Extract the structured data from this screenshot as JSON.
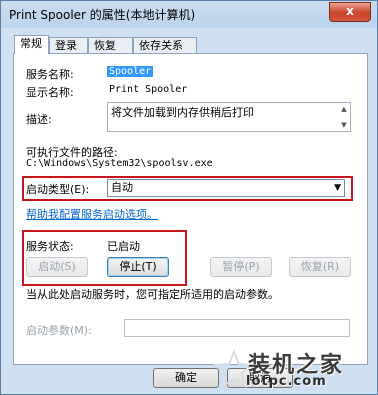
{
  "window": {
    "title": "Print Spooler 的属性(本地计算机)",
    "close_glyph": "x"
  },
  "tabs": [
    {
      "label": "常规",
      "active": true
    },
    {
      "label": "登录",
      "active": false
    },
    {
      "label": "恢复",
      "active": false
    },
    {
      "label": "依存关系",
      "active": false
    }
  ],
  "general": {
    "service_name_label": "服务名称:",
    "service_name_value": "Spooler",
    "display_name_label": "显示名称:",
    "display_name_value": "Print Spooler",
    "description_label": "描述:",
    "description_value": "将文件加载到内存供稍后打印",
    "exec_path_label": "可执行文件的路径:",
    "exec_path_value": "C:\\Windows\\System32\\spoolsv.exe",
    "startup_type_label": "启动类型(E):",
    "startup_type_value": "自动",
    "help_link": "帮助我配置服务启动选项。",
    "service_status_label": "服务状态:",
    "service_status_value": "已启动",
    "buttons": {
      "start": "启动(S)",
      "stop": "停止(T)",
      "pause": "暂停(P)",
      "resume": "恢复(R)"
    },
    "hint_text": "当从此处启动服务时，您可指定所适用的启动参数。",
    "start_params_label": "启动参数(M):",
    "start_params_value": ""
  },
  "footer": {
    "ok_label": "确定",
    "cancel_label": "取消"
  },
  "watermark": {
    "text": "装机之家",
    "url": "lotpc.com"
  },
  "colors": {
    "highlight_box": "#c4161c",
    "link": "#0066cc",
    "selection": "#3399ff"
  }
}
